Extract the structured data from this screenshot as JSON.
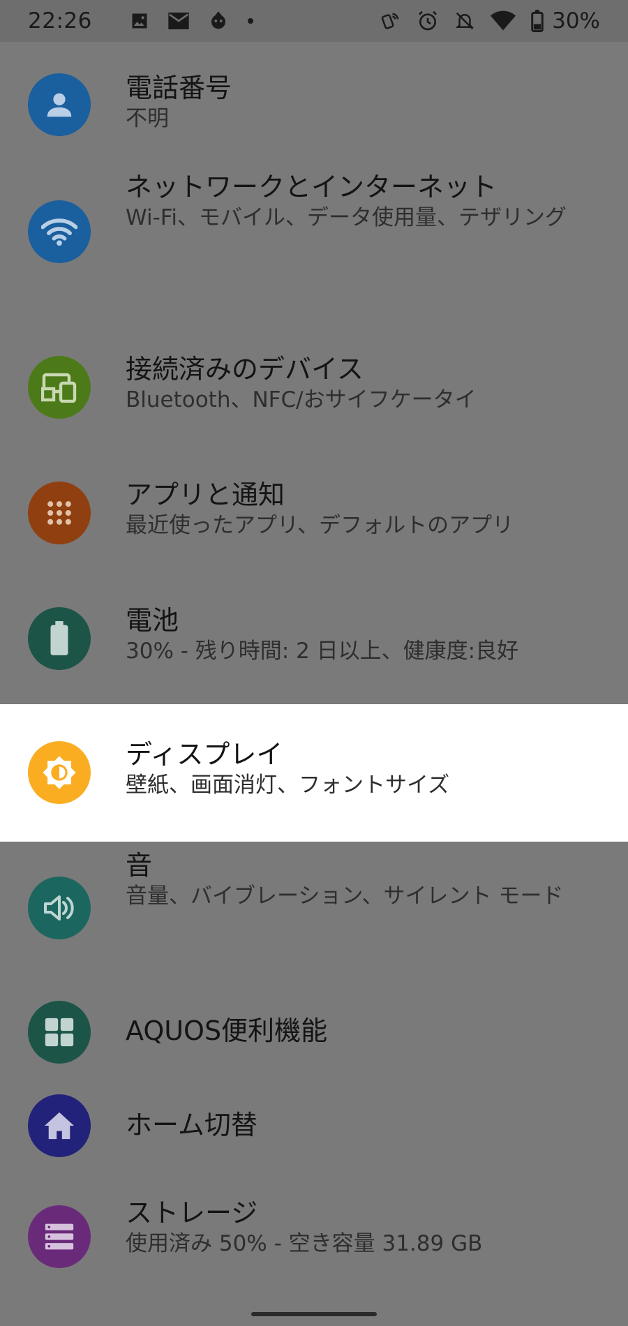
{
  "status_bar": {
    "time": "22:26",
    "battery_percent": "30%",
    "left_icons": [
      "image-icon",
      "mail-icon",
      "app-notification-icon",
      "dot-icon"
    ],
    "right_icons": [
      "nfc-icon",
      "alarm-icon",
      "bell-off-icon",
      "wifi-icon",
      "battery-icon"
    ]
  },
  "settings": {
    "items": [
      {
        "title": "電話番号",
        "summary": "不明",
        "icon": "person-icon",
        "color": "#1a5f9e"
      },
      {
        "title": "ネットワークとインターネット",
        "summary": "Wi-Fi、モバイル、データ使用量、テザリング",
        "icon": "wifi-icon",
        "color": "#1a5f9e"
      },
      {
        "title": "接続済みのデバイス",
        "summary": "Bluetooth、NFC/おサイフケータイ",
        "icon": "devices-icon",
        "color": "#4c7a18"
      },
      {
        "title": "アプリと通知",
        "summary": "最近使ったアプリ、デフォルトのアプリ",
        "icon": "apps-grid-icon",
        "color": "#904010"
      },
      {
        "title": "電池",
        "summary": "30% - 残り時間: 2 日以上、健康度:良好",
        "icon": "battery-icon",
        "color": "#1c5448"
      },
      {
        "title": "ディスプレイ",
        "summary": "壁紙、画面消灯、フォントサイズ",
        "icon": "brightness-icon",
        "color": "#fbad22"
      },
      {
        "title": "音",
        "summary": "音量、バイブレーション、サイレント モード",
        "icon": "volume-icon",
        "color": "#1c6660"
      },
      {
        "title": "AQUOS便利機能",
        "summary": "",
        "icon": "grid-icon",
        "color": "#1c5448"
      },
      {
        "title": "ホーム切替",
        "summary": "",
        "icon": "home-icon",
        "color": "#23227a"
      },
      {
        "title": "ストレージ",
        "summary": "使用済み 50% - 空き容量 31.89 GB",
        "icon": "storage-icon",
        "color": "#6a2a7a"
      }
    ]
  }
}
